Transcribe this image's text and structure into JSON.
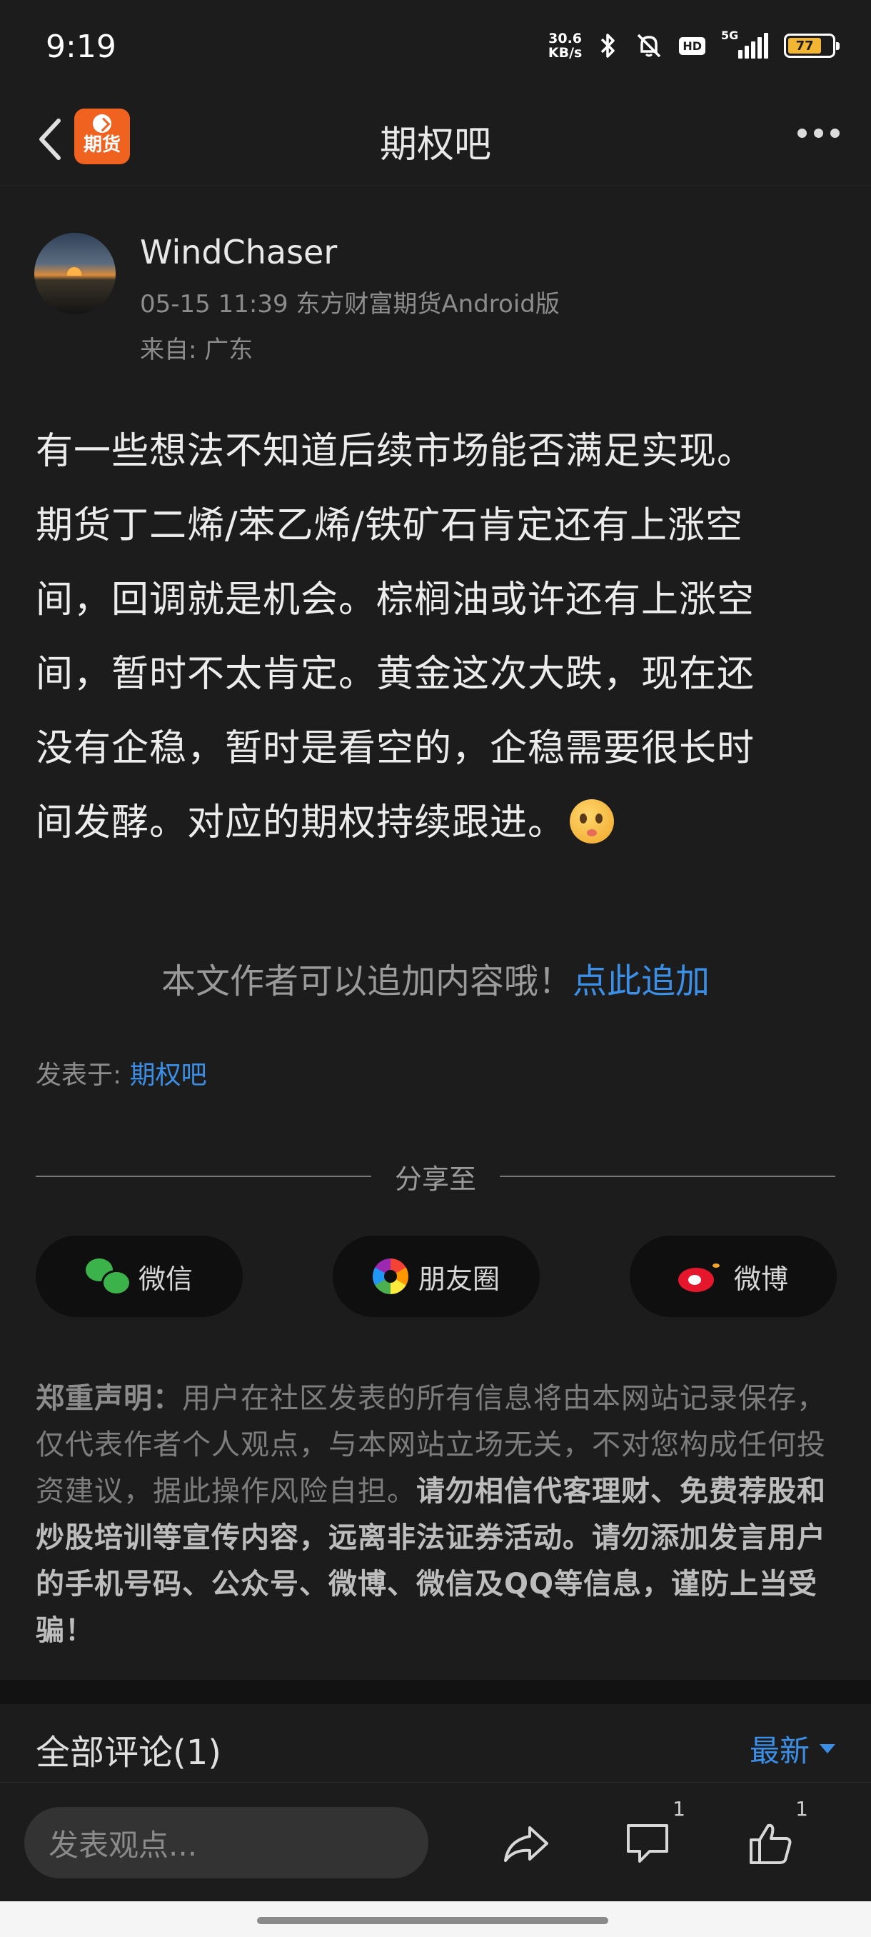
{
  "status_bar": {
    "time": "9:19",
    "net_speed_value": "30.6",
    "net_speed_unit": "KB/s",
    "hd_label": "HD",
    "network_label": "5G",
    "battery_level": "77"
  },
  "nav": {
    "title": "期权吧",
    "app_badge_label": "期货"
  },
  "author": {
    "name": "WindChaser",
    "meta": "05-15 11:39  东方财富期货Android版",
    "location": "来自: 广东"
  },
  "post": {
    "lines": [
      "有一些想法不知道后续市场能否满足实现。",
      "期货丁二烯/苯乙烯/铁矿石肯定还有上涨空",
      "间，回调就是机会。棕榈油或许还有上涨空",
      "间，暂时不太肯定。黄金这次大跌，现在还",
      "没有企稳，暂时是看空的，企稳需要很长时",
      "间发酵。对应的期权持续跟进。"
    ]
  },
  "append": {
    "tip": "本文作者可以追加内容哦！",
    "link": "点此追加"
  },
  "posted_in": {
    "label": "发表于: ",
    "forum": "期权吧"
  },
  "share": {
    "title": "分享至",
    "wechat": "微信",
    "moments": "朋友圈",
    "weibo": "微博"
  },
  "disclaimer": {
    "lead": "郑重声明",
    "colon": "：",
    "normal": "用户在社区发表的所有信息将由本网站记录保存，仅代表作者个人观点，与本网站立场无关，不对您构成任何投资建议，据此操作风险自担。",
    "strong": "请勿相信代客理财、免费荐股和炒股培训等宣传内容，远离非法证券活动。请勿添加发言用户的手机号码、公众号、微博、微信及QQ等信息，谨防上当受骗！"
  },
  "comments": {
    "title": "全部评论(1)",
    "sort_label": "最新"
  },
  "bottom_bar": {
    "input_placeholder": "发表观点...",
    "comment_count": "1",
    "like_count": "1"
  },
  "colors": {
    "accent_blue": "#3c8fe6",
    "brand_orange": "#f0621f",
    "background": "#1c1c1c"
  }
}
